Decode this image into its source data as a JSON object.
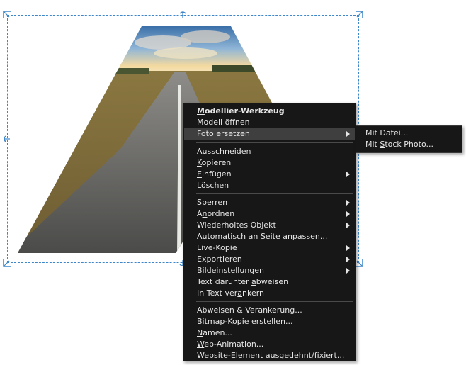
{
  "context_menu": {
    "items": [
      {
        "pre": "",
        "key": "M",
        "post": "odellier-Werkzeug"
      },
      {
        "pre": "Modell öffnen",
        "key": "",
        "post": ""
      },
      {
        "pre": "Foto ",
        "key": "e",
        "post": "rsetzen"
      },
      {
        "pre": "",
        "key": "A",
        "post": "usschneiden"
      },
      {
        "pre": "",
        "key": "K",
        "post": "opieren"
      },
      {
        "pre": "",
        "key": "E",
        "post": "infügen"
      },
      {
        "pre": "",
        "key": "L",
        "post": "öschen"
      },
      {
        "pre": "",
        "key": "S",
        "post": "perren"
      },
      {
        "pre": "A",
        "key": "n",
        "post": "ordnen"
      },
      {
        "pre": "Wiederholtes Objekt",
        "key": "",
        "post": ""
      },
      {
        "pre": "Automatisch an Seite anpassen...",
        "key": "",
        "post": ""
      },
      {
        "pre": "Live-Kopie",
        "key": "",
        "post": ""
      },
      {
        "pre": "Exportieren",
        "key": "",
        "post": ""
      },
      {
        "pre": "",
        "key": "B",
        "post": "ildeinstellungen"
      },
      {
        "pre": "Text darunter ",
        "key": "a",
        "post": "bweisen"
      },
      {
        "pre": "In Text ver",
        "key": "a",
        "post": "nkern"
      },
      {
        "pre": "Abweisen & Verankerung...",
        "key": "",
        "post": ""
      },
      {
        "pre": "",
        "key": "B",
        "post": "itmap-Kopie erstellen..."
      },
      {
        "pre": "",
        "key": "N",
        "post": "amen..."
      },
      {
        "pre": "",
        "key": "W",
        "post": "eb-Animation..."
      },
      {
        "pre": "Website-Element ausgedehnt/fixiert...",
        "key": "",
        "post": ""
      }
    ]
  },
  "submenu": {
    "items": [
      {
        "pre": "Mit Datei...",
        "key": "",
        "post": ""
      },
      {
        "pre": "Mit ",
        "key": "S",
        "post": "tock Photo..."
      }
    ]
  },
  "colors": {
    "menu_bg": "#171717",
    "menu_highlight": "#3f3f3f",
    "menu_text": "#e6e6e6",
    "selection_border": "#3d86c9"
  }
}
